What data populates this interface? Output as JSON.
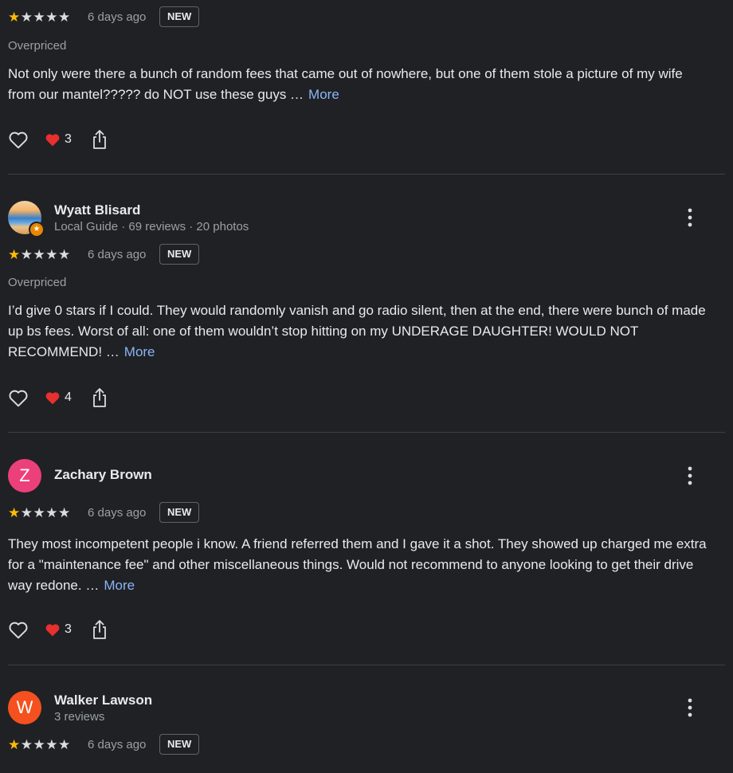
{
  "colors": {
    "background": "#202124",
    "star": "#fbbc04",
    "link": "#8ab4f8",
    "heart": "#e8302f",
    "muted": "#9aa0a6"
  },
  "icons": {
    "like": "heart-outline-icon",
    "reaction": "red-heart-icon",
    "share": "share-icon",
    "menu": "more-vert-icon",
    "star": "star-icon"
  },
  "reviews": [
    {
      "rating": 1,
      "time": "6 days ago",
      "badge": "NEW",
      "tag": "Overpriced",
      "text": "Not only were there a bunch of random fees that came out of nowhere, but one of them stole a picture of my wife from our mantel????? do NOT use these guys …",
      "more": "More",
      "likes": "3"
    },
    {
      "name": "Wyatt Blisard",
      "meta": "Local Guide · 69 reviews · 20 photos",
      "rating": 1,
      "time": "6 days ago",
      "badge": "NEW",
      "tag": "Overpriced",
      "text": "I’d give 0 stars if I could. They would randomly vanish and go radio silent, then at the end, there were bunch of made up bs fees. Worst of all: one of them wouldn’t stop hitting on my UNDERAGE DAUGHTER! WOULD NOT RECOMMEND! …",
      "more": "More",
      "likes": "4"
    },
    {
      "name": "Zachary Brown",
      "initial": "Z",
      "avatar_color": "#ec407a",
      "rating": 1,
      "time": "6 days ago",
      "badge": "NEW",
      "text": "They most incompetent people i know. A friend referred them and I gave it a shot. They showed up charged me extra for a \"maintenance fee\" and other miscellaneous things. Would not recommend to anyone looking to get their drive way redone. …",
      "more": "More",
      "likes": "3"
    },
    {
      "name": "Walker Lawson",
      "initial": "W",
      "avatar_color": "#f4511e",
      "meta": "3 reviews",
      "rating": 1,
      "time": "6 days ago",
      "badge": "NEW"
    }
  ]
}
